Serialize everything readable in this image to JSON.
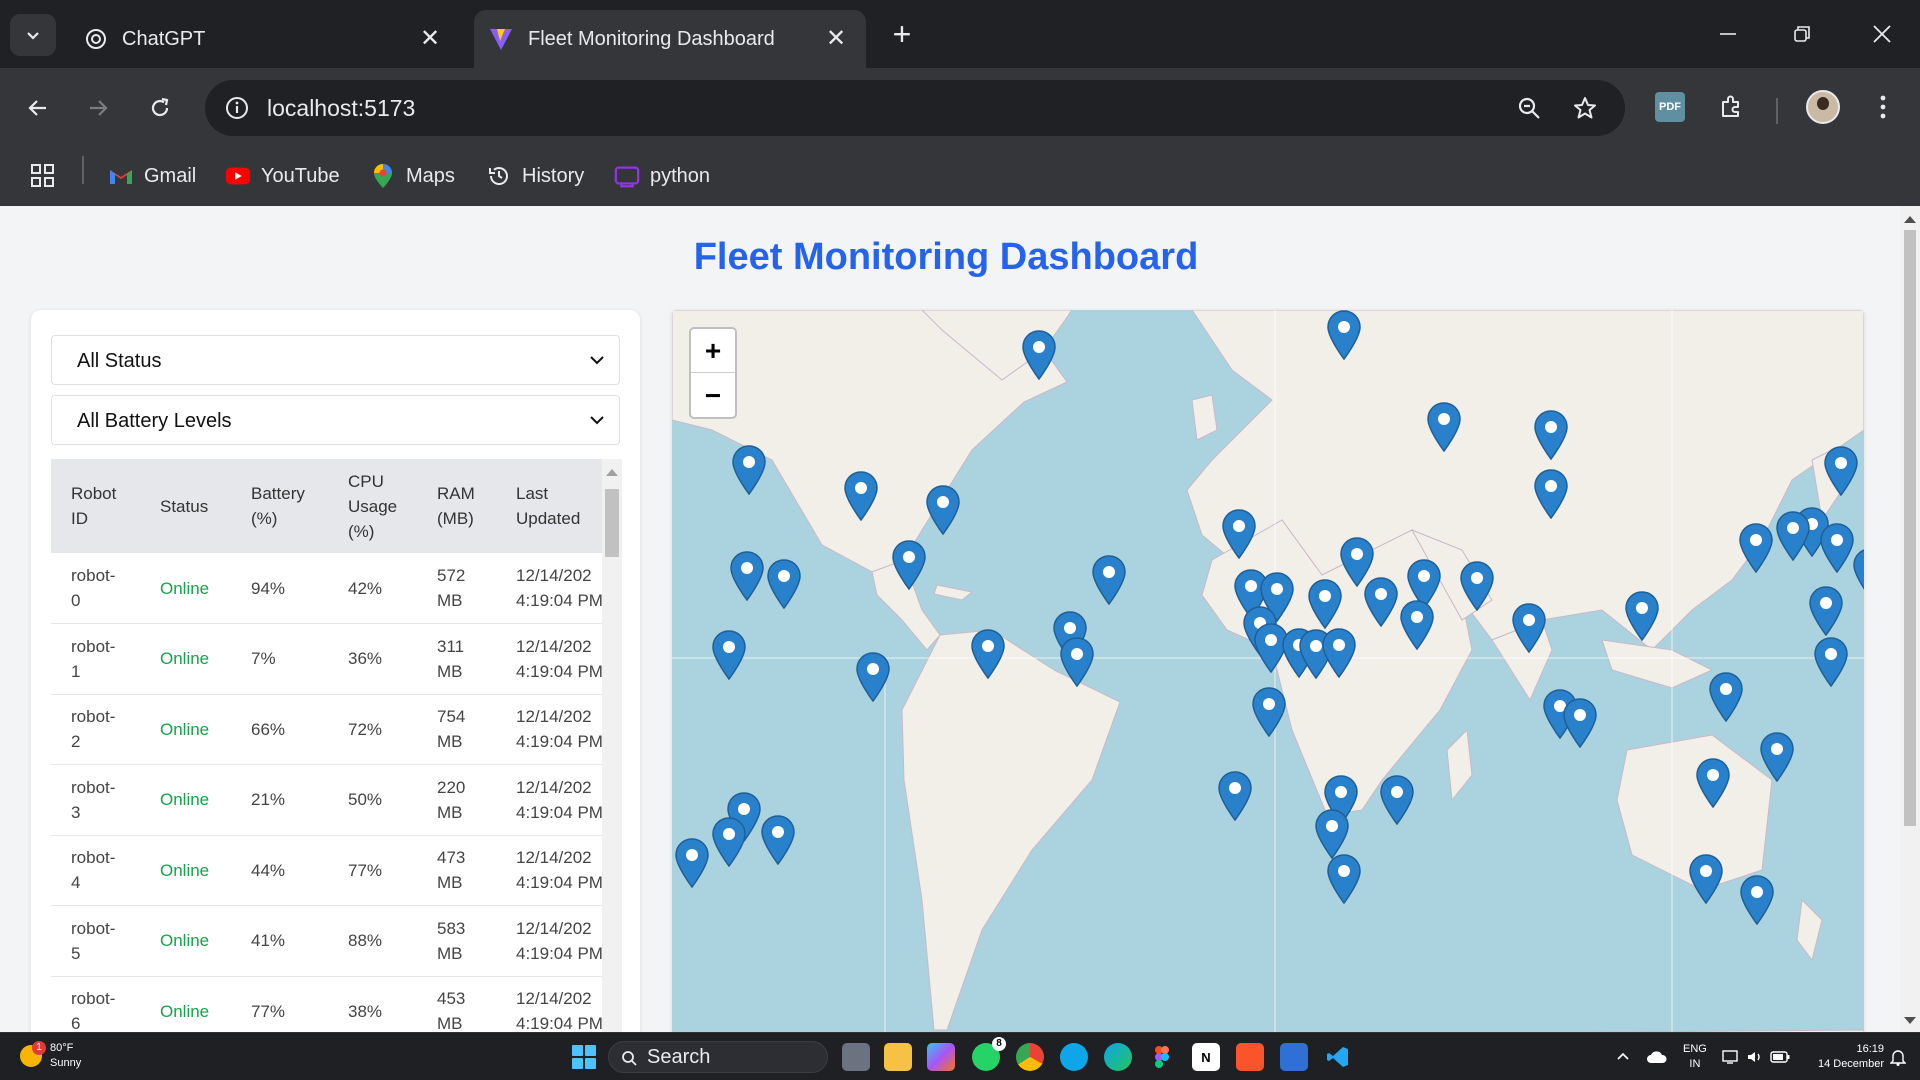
{
  "browser": {
    "tabs": [
      {
        "title": "ChatGPT",
        "active": false
      },
      {
        "title": "Fleet Monitoring Dashboard",
        "active": true
      }
    ],
    "url": "localhost:5173",
    "bookmarks": [
      "Gmail",
      "YouTube",
      "Maps",
      "History",
      "python"
    ],
    "extensions": {
      "pdf_label": "PDF"
    }
  },
  "dashboard": {
    "title": "Fleet Monitoring Dashboard",
    "filters": {
      "status": "All Status",
      "battery": "All Battery Levels"
    },
    "table": {
      "columns": [
        [
          "Robot",
          "ID"
        ],
        [
          "Status"
        ],
        [
          "Battery",
          "(%)"
        ],
        [
          "CPU",
          "Usage",
          "(%)"
        ],
        [
          "RAM",
          "(MB)"
        ],
        [
          "Last",
          "Updated"
        ]
      ],
      "rows": [
        {
          "id_a": "robot-",
          "id_b": "0",
          "status": "Online",
          "battery": "94%",
          "cpu": "42%",
          "ram_a": "572",
          "ram_b": "MB",
          "date": "12/14/202",
          "time": "4:19:04 PM"
        },
        {
          "id_a": "robot-",
          "id_b": "1",
          "status": "Online",
          "battery": "7%",
          "cpu": "36%",
          "ram_a": "311",
          "ram_b": "MB",
          "date": "12/14/202",
          "time": "4:19:04 PM"
        },
        {
          "id_a": "robot-",
          "id_b": "2",
          "status": "Online",
          "battery": "66%",
          "cpu": "72%",
          "ram_a": "754",
          "ram_b": "MB",
          "date": "12/14/202",
          "time": "4:19:04 PM"
        },
        {
          "id_a": "robot-",
          "id_b": "3",
          "status": "Online",
          "battery": "21%",
          "cpu": "50%",
          "ram_a": "220",
          "ram_b": "MB",
          "date": "12/14/202",
          "time": "4:19:04 PM"
        },
        {
          "id_a": "robot-",
          "id_b": "4",
          "status": "Online",
          "battery": "44%",
          "cpu": "77%",
          "ram_a": "473",
          "ram_b": "MB",
          "date": "12/14/202",
          "time": "4:19:04 PM"
        },
        {
          "id_a": "robot-",
          "id_b": "5",
          "status": "Online",
          "battery": "41%",
          "cpu": "88%",
          "ram_a": "583",
          "ram_b": "MB",
          "date": "12/14/202",
          "time": "4:19:04 PM"
        },
        {
          "id_a": "robot-",
          "id_b": "6",
          "status": "Online",
          "battery": "77%",
          "cpu": "38%",
          "ram_a": "453",
          "ram_b": "MB",
          "date": "12/14/202",
          "time": "4:19:04 PM"
        }
      ]
    },
    "map": {
      "zoom_in": "+",
      "zoom_out": "−",
      "marker_color": "#2a81cb"
    }
  },
  "taskbar": {
    "weather": {
      "temp": "80°F",
      "condition": "Sunny",
      "badge": "1"
    },
    "search_placeholder": "Search",
    "whatsapp_badge": "8",
    "tray": {
      "lang": "ENG",
      "region": "IN",
      "time": "16:19",
      "date": "14 December"
    }
  },
  "colors": {
    "title": "#2563eb",
    "status_online": "#16a34a",
    "map_water": "#aad3df",
    "map_land": "#f2efe9"
  }
}
